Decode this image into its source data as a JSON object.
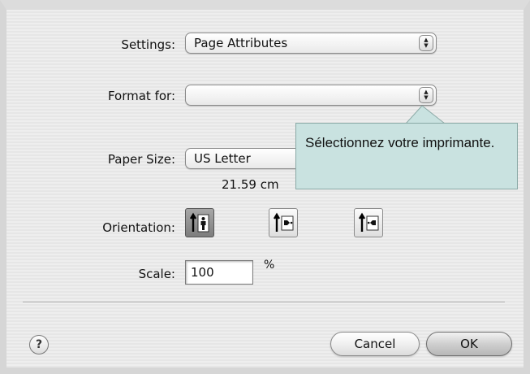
{
  "settings": {
    "label": "Settings:",
    "value": "Page Attributes"
  },
  "format_for": {
    "label": "Format for:",
    "value": ""
  },
  "paper_size": {
    "label": "Paper Size:",
    "value": "US Letter",
    "dimensions": "21.59 cm"
  },
  "orientation": {
    "label": "Orientation:",
    "options": [
      {
        "icon": "portrait-orientation-icon",
        "selected": true
      },
      {
        "icon": "landscape-left-orientation-icon",
        "selected": false
      },
      {
        "icon": "landscape-right-orientation-icon",
        "selected": false
      }
    ]
  },
  "scale": {
    "label": "Scale:",
    "value": "100",
    "unit": "%"
  },
  "buttons": {
    "help": "?",
    "cancel": "Cancel",
    "ok": "OK"
  },
  "callout": {
    "text": "Sélectionnez votre imprimante."
  }
}
